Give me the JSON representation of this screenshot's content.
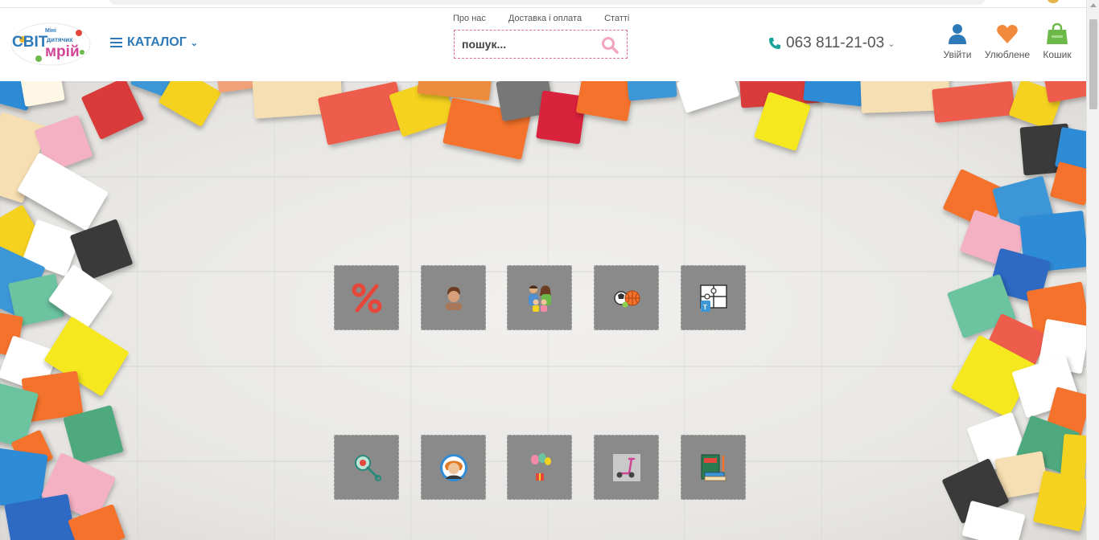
{
  "header": {
    "logo": {
      "line1": "Міні",
      "line2": "СВІТ",
      "line3": "дитячих",
      "line4": "мрій"
    },
    "catalog_label": "КАТАЛОГ",
    "top_links": [
      "Про нас",
      "Доставка і оплата",
      "Статті"
    ],
    "search": {
      "placeholder": "пошук..."
    },
    "phone": "063  811-21-03",
    "actions": [
      {
        "label": "Увійти",
        "icon": "user-icon"
      },
      {
        "label": "Улюблене",
        "icon": "heart-icon"
      },
      {
        "label": "Кошик",
        "icon": "bag-icon"
      }
    ]
  },
  "colors": {
    "brand_blue": "#2e7ab8",
    "search_border": "#e07090",
    "phone_icon": "#1aa39a",
    "user_icon": "#2e7ab8",
    "heart_icon": "#f28a3c",
    "bag_icon": "#6cb94a",
    "tile_bg": "#8a8a8a"
  },
  "categories": [
    {
      "icon": "percent-icon"
    },
    {
      "icon": "boy-icon"
    },
    {
      "icon": "family-icon"
    },
    {
      "icon": "sports-balls-icon"
    },
    {
      "icon": "puzzle-icon"
    },
    {
      "icon": "baby-rattle-icon"
    },
    {
      "icon": "girl-icon"
    },
    {
      "icon": "balloons-gift-icon"
    },
    {
      "icon": "scooter-icon"
    },
    {
      "icon": "books-icon"
    }
  ]
}
